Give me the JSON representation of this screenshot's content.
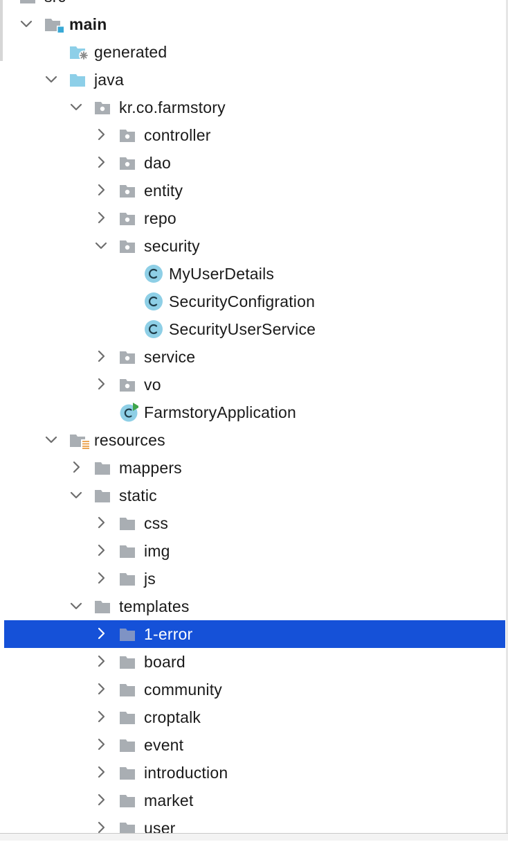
{
  "colors": {
    "selection": "#1551d8",
    "folder_gray": "#a9aeb3",
    "folder_source": "#8dcfe8",
    "class_badge": "#8ecfe6",
    "module_square": "#3aa9d6",
    "run_arrow": "#3fa44a"
  },
  "tree": [
    {
      "label": "src",
      "depth": 1,
      "state": "expanded",
      "icon": "folder-icon",
      "partial": true
    },
    {
      "label": "main",
      "depth": 2,
      "state": "expanded",
      "icon": "module-folder-icon",
      "bold": true
    },
    {
      "label": "generated",
      "depth": 3,
      "state": "none",
      "icon": "generated-sources-folder-icon"
    },
    {
      "label": "java",
      "depth": 3,
      "state": "expanded",
      "icon": "source-root-folder-icon"
    },
    {
      "label": "kr.co.farmstory",
      "depth": 4,
      "state": "expanded",
      "icon": "package-icon"
    },
    {
      "label": "controller",
      "depth": 5,
      "state": "collapsed",
      "icon": "package-icon"
    },
    {
      "label": "dao",
      "depth": 5,
      "state": "collapsed",
      "icon": "package-icon"
    },
    {
      "label": "entity",
      "depth": 5,
      "state": "collapsed",
      "icon": "package-icon"
    },
    {
      "label": "repo",
      "depth": 5,
      "state": "collapsed",
      "icon": "package-icon"
    },
    {
      "label": "security",
      "depth": 5,
      "state": "expanded",
      "icon": "package-icon"
    },
    {
      "label": "MyUserDetails",
      "depth": 6,
      "state": "none",
      "icon": "class-icon"
    },
    {
      "label": "SecurityConfigration",
      "depth": 6,
      "state": "none",
      "icon": "class-icon"
    },
    {
      "label": "SecurityUserService",
      "depth": 6,
      "state": "none",
      "icon": "class-icon"
    },
    {
      "label": "service",
      "depth": 5,
      "state": "collapsed",
      "icon": "package-icon"
    },
    {
      "label": "vo",
      "depth": 5,
      "state": "collapsed",
      "icon": "package-icon"
    },
    {
      "label": "FarmstoryApplication",
      "depth": 5,
      "state": "none",
      "icon": "application-class-icon"
    },
    {
      "label": "resources",
      "depth": 3,
      "state": "expanded",
      "icon": "resources-root-folder-icon"
    },
    {
      "label": "mappers",
      "depth": 4,
      "state": "collapsed",
      "icon": "folder-icon"
    },
    {
      "label": "static",
      "depth": 4,
      "state": "expanded",
      "icon": "folder-icon"
    },
    {
      "label": "css",
      "depth": 5,
      "state": "collapsed",
      "icon": "folder-icon"
    },
    {
      "label": "img",
      "depth": 5,
      "state": "collapsed",
      "icon": "folder-icon"
    },
    {
      "label": "js",
      "depth": 5,
      "state": "collapsed",
      "icon": "folder-icon"
    },
    {
      "label": "templates",
      "depth": 4,
      "state": "expanded",
      "icon": "folder-icon"
    },
    {
      "label": "1-error",
      "depth": 5,
      "state": "collapsed",
      "icon": "folder-icon",
      "selected": true
    },
    {
      "label": "board",
      "depth": 5,
      "state": "collapsed",
      "icon": "folder-icon"
    },
    {
      "label": "community",
      "depth": 5,
      "state": "collapsed",
      "icon": "folder-icon"
    },
    {
      "label": "croptalk",
      "depth": 5,
      "state": "collapsed",
      "icon": "folder-icon"
    },
    {
      "label": "event",
      "depth": 5,
      "state": "collapsed",
      "icon": "folder-icon"
    },
    {
      "label": "introduction",
      "depth": 5,
      "state": "collapsed",
      "icon": "folder-icon"
    },
    {
      "label": "market",
      "depth": 5,
      "state": "collapsed",
      "icon": "folder-icon"
    },
    {
      "label": "user",
      "depth": 5,
      "state": "collapsed",
      "icon": "folder-icon"
    }
  ]
}
